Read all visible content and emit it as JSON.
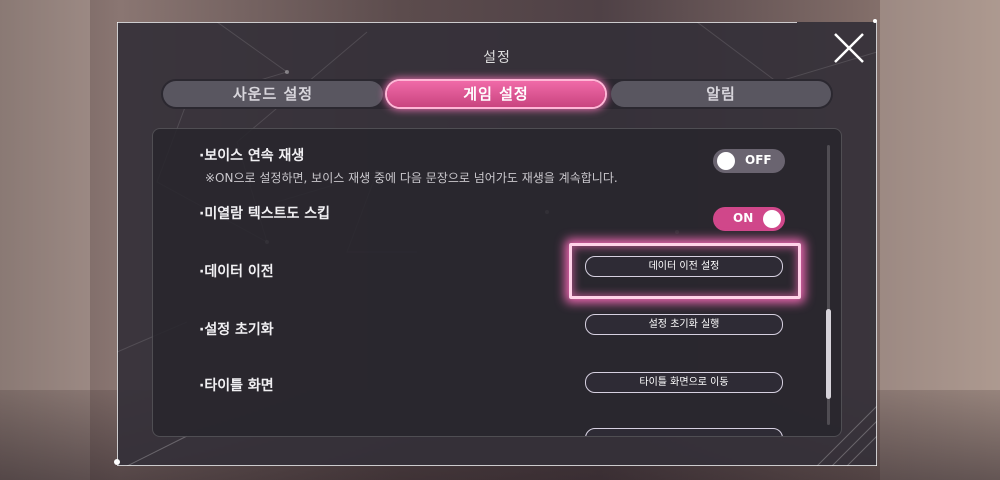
{
  "dialog": {
    "title": "설정",
    "close_icon": "close-x-icon"
  },
  "tabs": [
    {
      "label": "사운드 설정",
      "active": false
    },
    {
      "label": "게임 설정",
      "active": true
    },
    {
      "label": "알림",
      "active": false
    }
  ],
  "settings": {
    "voice_continuous": {
      "label": "·보이스 연속 재생",
      "description": "※ON으로 설정하면, 보이스 재생 중에 다음 문장으로 넘어가도 재생을 계속합니다.",
      "toggle_text": "OFF",
      "value": false
    },
    "skip_unread": {
      "label": "·미열람 텍스트도 스킵",
      "toggle_text": "ON",
      "value": true
    },
    "data_transfer": {
      "label": "·데이터 이전",
      "button": "데이터 이전 설정"
    },
    "reset": {
      "label": "·설정 초기화",
      "button": "설정 초기화 실행"
    },
    "title_screen": {
      "label": "·타이틀 화면",
      "button": "타이틀 화면으로 이동"
    }
  },
  "colors": {
    "accent_pink": "#d0478a",
    "highlight_glow": "#ff6ebe"
  }
}
